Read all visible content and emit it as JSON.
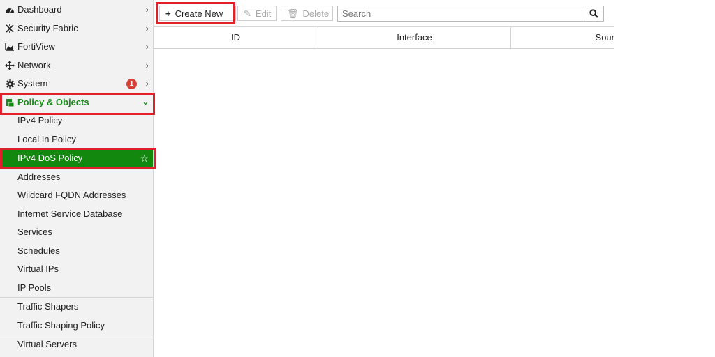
{
  "sidebar": {
    "items": [
      {
        "label": "Dashboard",
        "icon": "dashboard-gauge-icon"
      },
      {
        "label": "Security Fabric",
        "icon": "security-fabric-icon"
      },
      {
        "label": "FortiView",
        "icon": "area-chart-icon"
      },
      {
        "label": "Network",
        "icon": "network-arrows-icon"
      },
      {
        "label": "System",
        "icon": "gear-icon",
        "badge": "1"
      }
    ],
    "group": {
      "label": "Policy & Objects",
      "icon": "policy-objects-icon"
    },
    "subitems": [
      "IPv4 Policy",
      "Local In Policy",
      "IPv4 DoS Policy",
      "Addresses",
      "Wildcard FQDN Addresses",
      "Internet Service Database",
      "Services",
      "Schedules",
      "Virtual IPs",
      "IP Pools",
      "Traffic Shapers",
      "Traffic Shaping Policy",
      "Virtual Servers"
    ],
    "active_subitem": "IPv4 DoS Policy"
  },
  "toolbar": {
    "create_new": "Create New",
    "edit": "Edit",
    "delete": "Delete",
    "search_placeholder": "Search"
  },
  "table": {
    "columns": [
      "ID",
      "Interface",
      "Sour"
    ]
  },
  "colors": {
    "accent_green": "#13880f",
    "highlight_red": "#e0202a",
    "badge_red": "#d9403a"
  }
}
